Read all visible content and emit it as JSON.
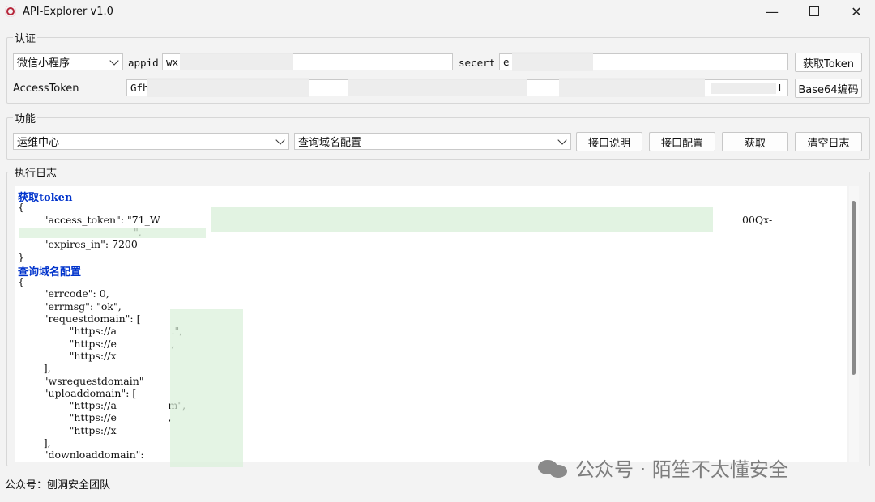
{
  "window": {
    "title": "API-Explorer v1.0",
    "minimize_glyph": "—",
    "close_glyph": "✕"
  },
  "auth": {
    "group_label": "认证",
    "platform_select": "微信小程序",
    "appid_label": "appid",
    "appid_value": "wx",
    "secret_label": "secert",
    "secret_value": "e",
    "get_token_label": "获取Token",
    "access_token_label": "AccessToken",
    "access_token_value": "Gfh",
    "access_token_tail": "L",
    "base64_label": "Base64编码"
  },
  "function": {
    "group_label": "功能",
    "category_select": "运维中心",
    "api_select": "查询域名配置",
    "doc_button": "接口说明",
    "config_button": "接口配置",
    "fetch_button": "获取",
    "clear_button": "清空日志"
  },
  "log": {
    "group_label": "执行日志",
    "lines": [
      {
        "text": "获取token",
        "head": true
      },
      {
        "text": "{"
      },
      {
        "text": "        \"access_token\": \"71_W",
        "tail": "00Qx-"
      },
      {
        "text": "                                    \","
      },
      {
        "text": "        \"expires_in\": 7200"
      },
      {
        "text": "}"
      },
      {
        "text": "查询域名配置",
        "head": true
      },
      {
        "text": "{"
      },
      {
        "text": "        \"errcode\": 0,"
      },
      {
        "text": "        \"errmsg\": \"ok\","
      },
      {
        "text": "        \"requestdomain\": ["
      },
      {
        "text": "                \"https://a                 .\","
      },
      {
        "text": "                \"https://e                 ,"
      },
      {
        "text": "                \"https://x"
      },
      {
        "text": "        ],"
      },
      {
        "text": "        \"wsrequestdomain\""
      },
      {
        "text": "        \"uploaddomain\": ["
      },
      {
        "text": "                \"https://a                m\","
      },
      {
        "text": "                \"https://e                ,"
      },
      {
        "text": "                \"https://x"
      },
      {
        "text": "        ],"
      },
      {
        "text": "        \"downloaddomain\":"
      }
    ]
  },
  "status_bar": {
    "text": "公众号：刨洞安全团队"
  },
  "watermark": {
    "text": "公众号 · 陌笙不太懂安全",
    "icon": "wechat-icon"
  }
}
